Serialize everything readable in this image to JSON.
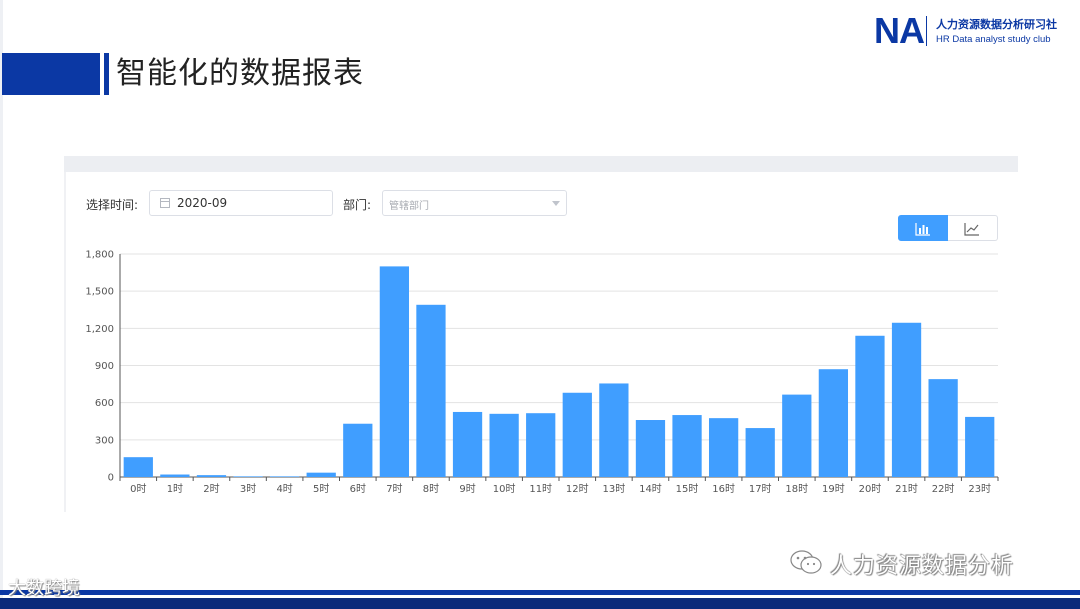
{
  "header": {
    "title": "智能化的数据报表",
    "logo_mark": "NA",
    "logo_cn": "人力资源数据分析研习社",
    "logo_en": "HR Data analyst study club"
  },
  "filters": {
    "time_label": "选择时间:",
    "time_value": "2020-09",
    "dept_label": "部门:",
    "dept_placeholder": "管辖部门"
  },
  "view_toggle": {
    "active": "bar",
    "options": [
      "bar-chart-icon",
      "line-chart-icon"
    ]
  },
  "colors": {
    "bar": "#409eff",
    "brand": "#0b38a4"
  },
  "watermark": {
    "text": "人力资源数据分析"
  },
  "footer_logo": {
    "text": "大数跨境"
  },
  "chart_data": {
    "type": "bar",
    "categories": [
      "0时",
      "1时",
      "2时",
      "3时",
      "4时",
      "5时",
      "6时",
      "7时",
      "8时",
      "9时",
      "10时",
      "11时",
      "12时",
      "13时",
      "14时",
      "15时",
      "16时",
      "17时",
      "18时",
      "19时",
      "20时",
      "21时",
      "22时",
      "23时"
    ],
    "values": [
      160,
      20,
      15,
      5,
      5,
      35,
      430,
      1700,
      1390,
      525,
      510,
      515,
      680,
      755,
      460,
      500,
      475,
      395,
      665,
      870,
      1140,
      1245,
      790,
      485
    ],
    "ylim": [
      0,
      1800
    ],
    "yticks": [
      "0",
      "300",
      "600",
      "900",
      "1,200",
      "1,500",
      "1,800"
    ],
    "ytick_values": [
      0,
      300,
      600,
      900,
      1200,
      1500,
      1800
    ],
    "grid": true,
    "legend": "none"
  }
}
